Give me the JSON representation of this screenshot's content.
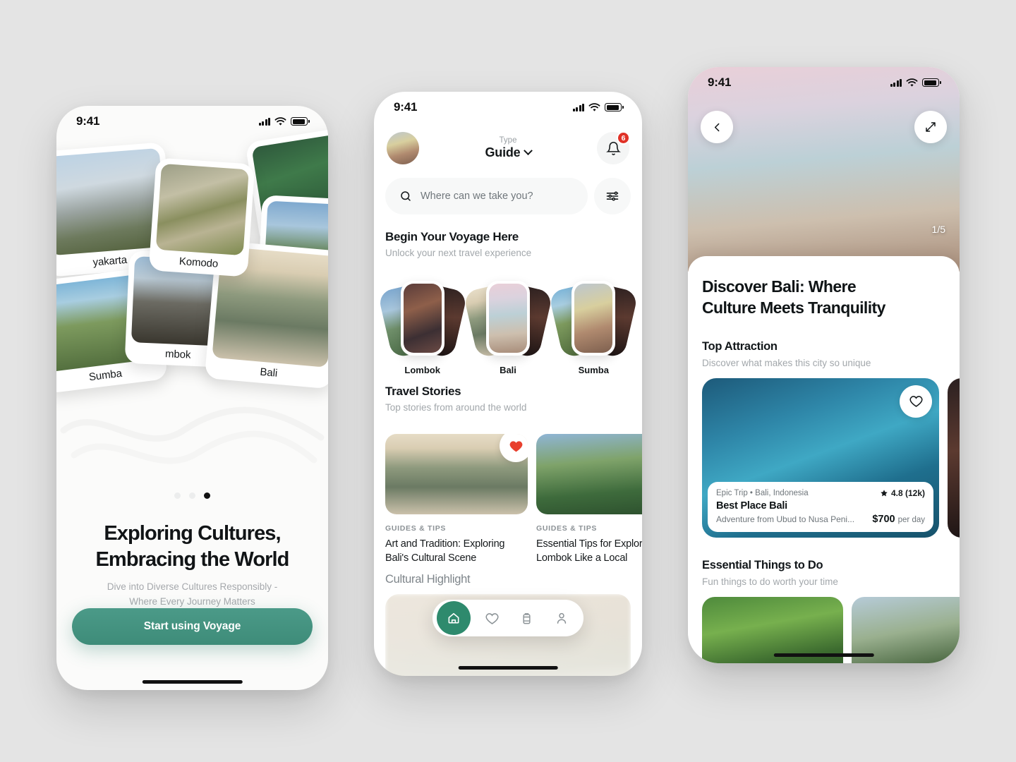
{
  "theme": {
    "accent": "#3e8c79",
    "nav_accent": "#2e8a6d",
    "badge": "#e03126",
    "bg": "#e4e4e4"
  },
  "onboarding": {
    "status_time": "9:41",
    "cards": [
      {
        "label": "yakarta"
      },
      {
        "label": "Sumba"
      },
      {
        "label": "Komodo"
      },
      {
        "label": "mbok"
      },
      {
        "label": "Bali"
      }
    ],
    "dots_total": 3,
    "dots_active": 3,
    "title_line1": "Exploring Cultures,",
    "title_line2": "Embracing the World",
    "sub_line1": "Dive into Diverse Cultures Responsibly -",
    "sub_line2": "Where Every Journey Matters",
    "cta_label": "Start using Voyage"
  },
  "home": {
    "status_time": "9:41",
    "avatar_name": "user-avatar",
    "type_label": "Type",
    "type_value": "Guide",
    "notification_count": "6",
    "search_placeholder": "Where can we take you?",
    "section1": {
      "title": "Begin Your Voyage Here",
      "subtitle": "Unlock your next travel experience"
    },
    "destinations": [
      {
        "name": "Lombok"
      },
      {
        "name": "Bali"
      },
      {
        "name": "Sumba"
      }
    ],
    "section2": {
      "title": "Travel Stories",
      "subtitle": "Top stories from around the world"
    },
    "stories": [
      {
        "kicker": "GUIDES & TIPS",
        "title": "Art and Tradition: Exploring Bali's Cultural Scene",
        "favorited": true
      },
      {
        "kicker": "GUIDES & TIPS",
        "title": "Essential Tips for Exploring Lombok Like a Local",
        "favorited": false
      }
    ],
    "section3": {
      "title": "Cultural Highlight"
    },
    "tabs": [
      {
        "icon": "home-icon",
        "active": true
      },
      {
        "icon": "heart-icon",
        "active": false
      },
      {
        "icon": "luggage-icon",
        "active": false
      },
      {
        "icon": "profile-icon",
        "active": false
      }
    ]
  },
  "detail": {
    "status_time": "9:41",
    "back_icon": "chevron-left-icon",
    "expand_icon": "expand-icon",
    "image_counter": "1/5",
    "title_line1": "Discover Bali: Where",
    "title_line2": "Culture Meets Tranquility",
    "top_attraction": {
      "title": "Top Attraction",
      "subtitle": "Discover what makes this city so unique"
    },
    "attractions": [
      {
        "meta": "Epic Trip • Bali, Indonesia",
        "name": "Best Place Bali",
        "description": "Adventure from Ubud to Nusa Peni...",
        "rating": "4.8 (12k)",
        "price": "$700",
        "price_unit": "per day",
        "favorited": false
      }
    ],
    "things_to_do": {
      "title": "Essential Things to Do",
      "subtitle": "Fun things to do worth your time"
    }
  }
}
